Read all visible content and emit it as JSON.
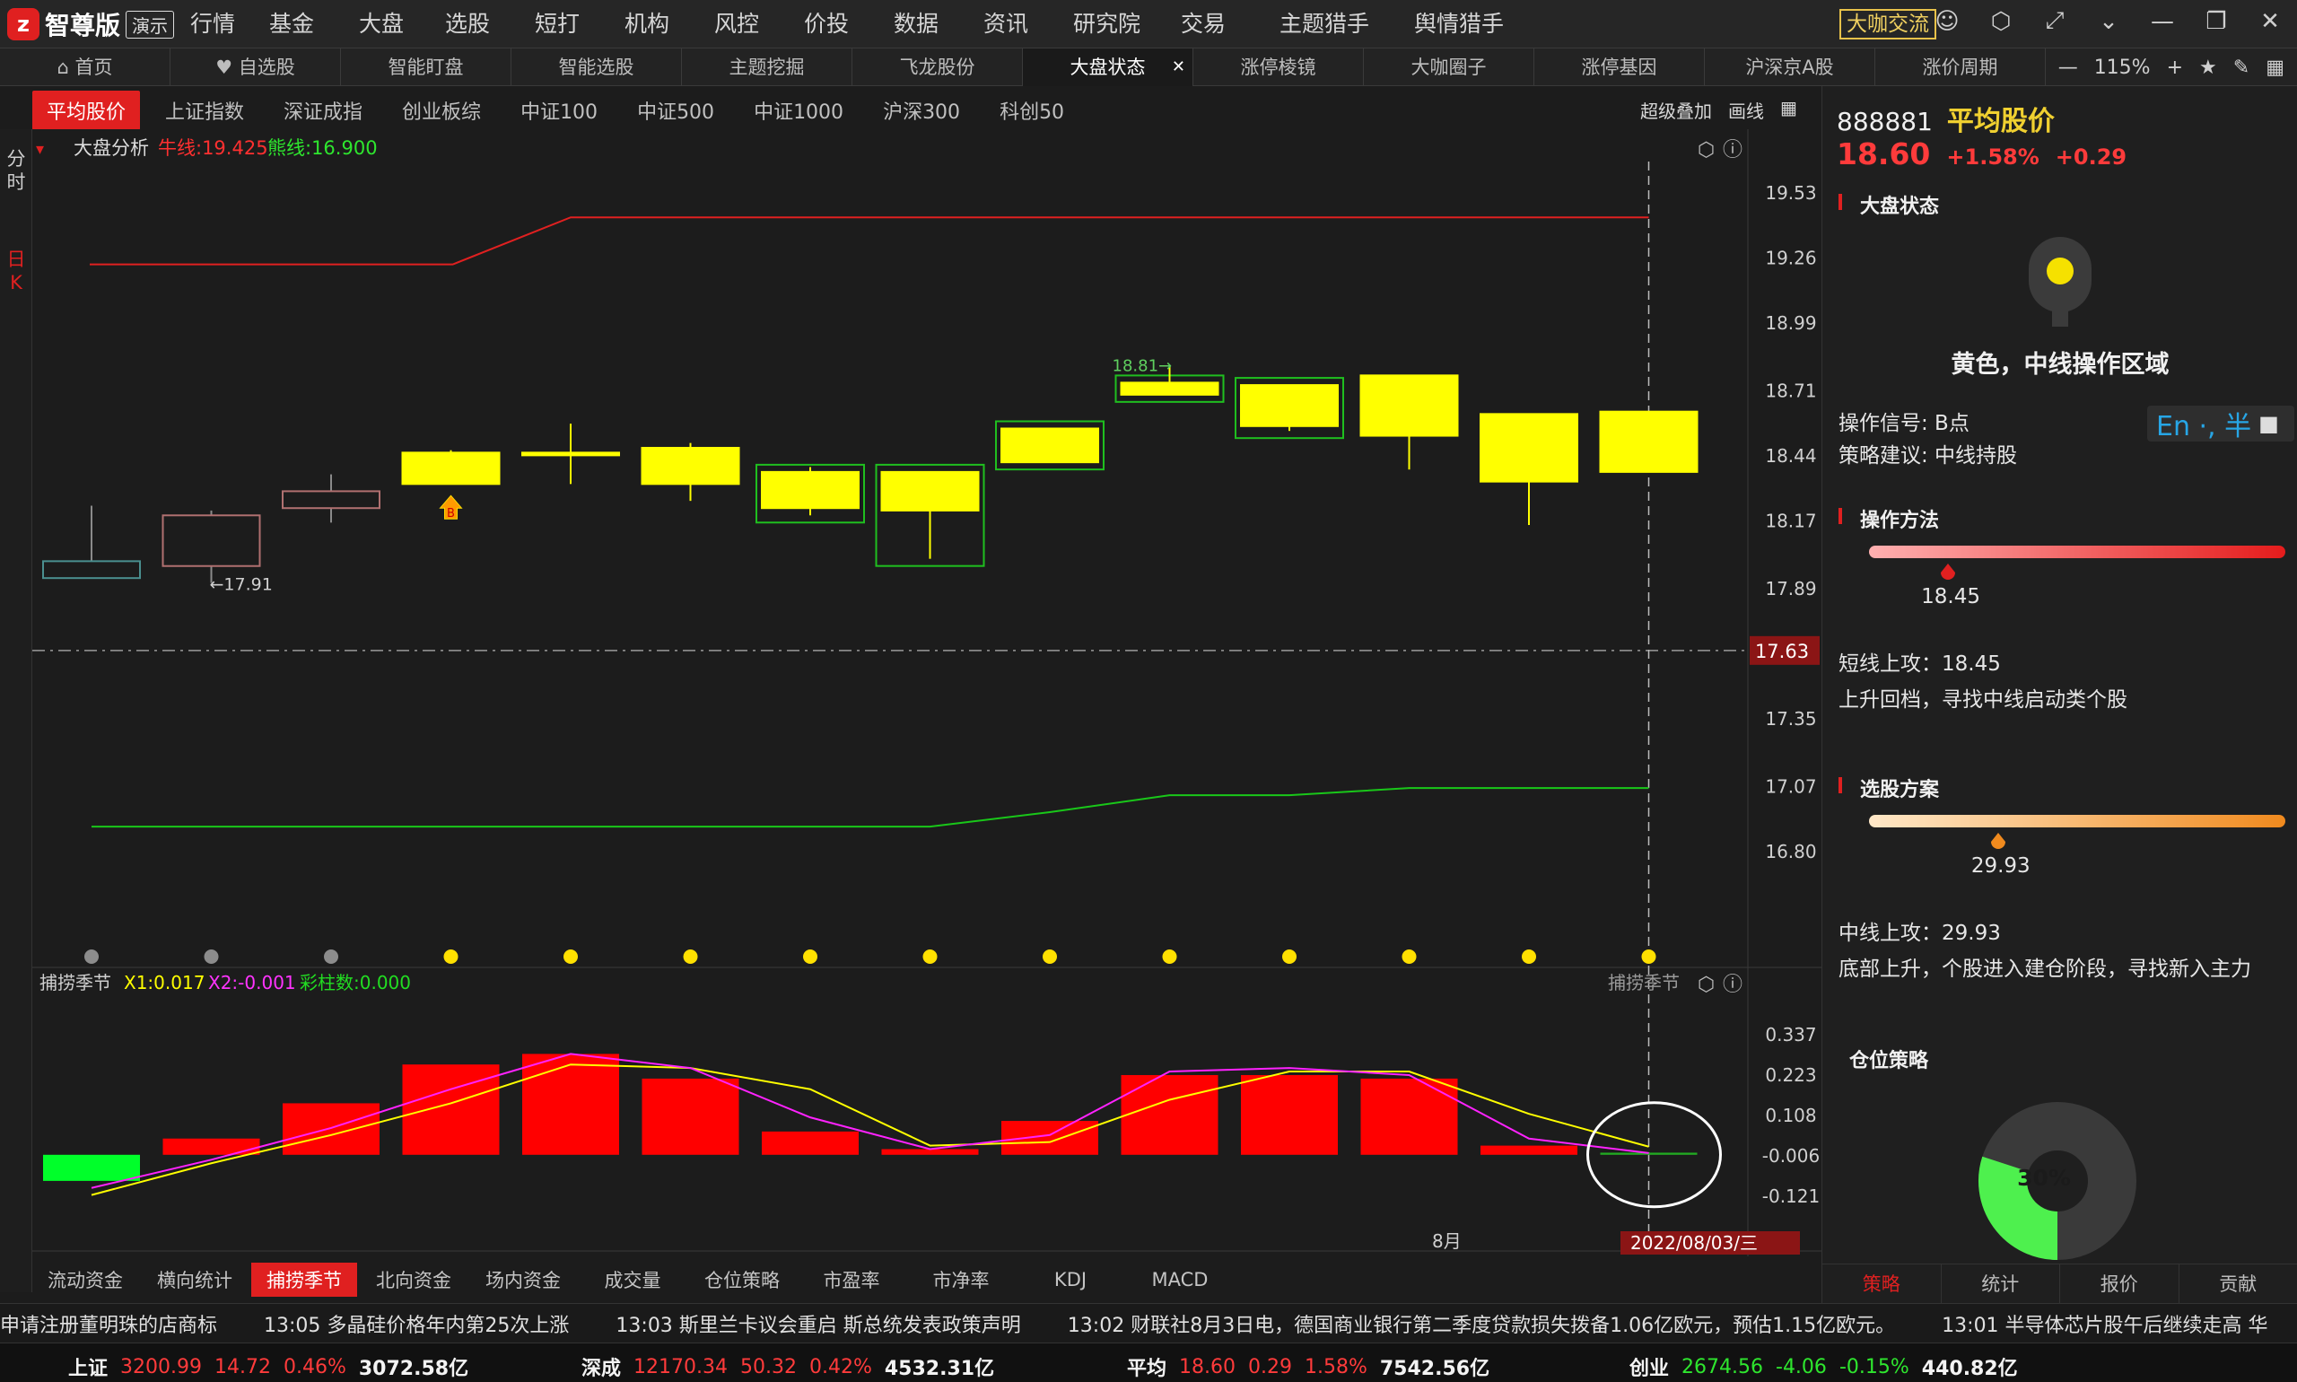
{
  "app": {
    "logo_text": "智尊版",
    "logo_badge": "演示",
    "menu": [
      "行情",
      "基金",
      "大盘",
      "选股",
      "短打",
      "机构",
      "风控",
      "价投",
      "数据",
      "资讯",
      "研究院",
      "交易",
      "主题猎手",
      "舆情猎手"
    ],
    "community_button": "大咖交流"
  },
  "tabs": [
    {
      "label": "首页",
      "icon": "home-icon"
    },
    {
      "label": "自选股",
      "icon": "heart-icon"
    },
    {
      "label": "智能盯盘"
    },
    {
      "label": "智能选股"
    },
    {
      "label": "主题挖掘"
    },
    {
      "label": "飞龙股份"
    },
    {
      "label": "大盘状态",
      "active": true,
      "closable": true
    },
    {
      "label": "涨停棱镜"
    },
    {
      "label": "大咖圈子"
    },
    {
      "label": "涨停基因"
    },
    {
      "label": "沪深京A股"
    },
    {
      "label": "涨价周期"
    }
  ],
  "zoom": {
    "minus": "—",
    "level": "115%",
    "plus": "+"
  },
  "index_tabs": [
    "平均股价",
    "上证指数",
    "深证成指",
    "创业板综",
    "中证100",
    "中证500",
    "中证1000",
    "沪深300",
    "科创50"
  ],
  "chart_tools": {
    "overlay": "超级叠加",
    "draw": "画线"
  },
  "left_strip": {
    "intraday": "分时",
    "daily": "日K"
  },
  "main_panel": {
    "title": "大盘分析",
    "bull_label": "牛线:19.425",
    "bear_label": "熊线:16.900",
    "price_ticks": [
      "19.53",
      "19.26",
      "18.99",
      "18.71",
      "18.44",
      "18.17",
      "17.89",
      "17.63",
      "17.35",
      "17.07",
      "16.80"
    ],
    "current_price_tag": "17.63",
    "low_marker": "17.91",
    "high_marker": "18.81"
  },
  "sub_panel": {
    "name": "捕捞季节",
    "x1_label": "X1:0.017",
    "x2_label": "X2:-0.001",
    "bars_label": "彩柱数:0.000",
    "y_ticks": [
      "0.337",
      "0.223",
      "0.108",
      "-0.006",
      "-0.121"
    ],
    "month_label": "8月",
    "date_tag": "2022/08/03/三"
  },
  "chart_data": {
    "type": "candlestick",
    "bull_line": [
      19.23,
      19.23,
      19.23,
      19.23,
      19.425,
      19.425,
      19.425,
      19.425,
      19.425,
      19.425,
      19.425,
      19.425,
      19.425,
      19.425
    ],
    "bear_line": [
      16.9,
      16.9,
      16.9,
      16.9,
      16.9,
      16.9,
      16.9,
      16.9,
      16.96,
      17.03,
      17.03,
      17.06,
      17.06,
      17.06
    ],
    "candles": [
      {
        "open": 18.0,
        "close": 17.93,
        "high": 18.23,
        "low": 17.93,
        "color": "gray"
      },
      {
        "open": 17.98,
        "close": 18.19,
        "high": 18.21,
        "low": 17.91,
        "color": "gray"
      },
      {
        "open": 18.22,
        "close": 18.29,
        "high": 18.36,
        "low": 18.16,
        "color": "gray"
      },
      {
        "open": 18.32,
        "close": 18.45,
        "high": 18.46,
        "low": 18.32,
        "color": "yellow"
      },
      {
        "open": 18.44,
        "close": 18.45,
        "high": 18.57,
        "low": 18.32,
        "color": "yellow"
      },
      {
        "open": 18.32,
        "close": 18.47,
        "high": 18.49,
        "low": 18.25,
        "color": "yellow"
      },
      {
        "open": 18.37,
        "close": 18.22,
        "high": 18.39,
        "low": 18.19,
        "color": "yellow"
      },
      {
        "open": 18.37,
        "close": 18.21,
        "high": 18.37,
        "low": 18.01,
        "color": "yellow"
      },
      {
        "open": 18.41,
        "close": 18.55,
        "high": 18.55,
        "low": 18.41,
        "color": "yellow"
      },
      {
        "open": 18.74,
        "close": 18.69,
        "high": 18.81,
        "low": 18.69,
        "color": "yellow"
      },
      {
        "open": 18.73,
        "close": 18.56,
        "high": 18.73,
        "low": 18.54,
        "color": "yellow"
      },
      {
        "open": 18.52,
        "close": 18.77,
        "high": 18.77,
        "low": 18.38,
        "color": "yellow"
      },
      {
        "open": 18.33,
        "close": 18.61,
        "high": 18.61,
        "low": 18.15,
        "color": "yellow"
      },
      {
        "open": 18.37,
        "close": 18.62,
        "high": 18.62,
        "low": 18.37,
        "color": "yellow"
      }
    ],
    "boxed_candles": [
      6,
      7,
      8,
      9,
      10
    ],
    "signal_dots": [
      "gray",
      "gray",
      "gray",
      "yellow",
      "yellow",
      "yellow",
      "yellow",
      "yellow",
      "yellow",
      "yellow",
      "yellow",
      "yellow",
      "yellow",
      "yellow"
    ],
    "buy_signal_index": 3,
    "indicator": {
      "bars": [
        -0.08,
        0.04,
        0.14,
        0.25,
        0.28,
        0.21,
        0.06,
        0.01,
        0.09,
        0.22,
        0.22,
        0.21,
        0.02,
        0.0
      ],
      "x1": [
        -0.12,
        -0.03,
        0.05,
        0.14,
        0.25,
        0.24,
        0.18,
        0.02,
        0.03,
        0.15,
        0.23,
        0.23,
        0.11,
        0.017
      ],
      "x2": [
        -0.1,
        -0.02,
        0.07,
        0.18,
        0.28,
        0.24,
        0.1,
        0.01,
        0.05,
        0.23,
        0.24,
        0.22,
        0.04,
        -0.001
      ]
    }
  },
  "indicator_tabs": [
    "流动资金",
    "横向统计",
    "捕捞季节",
    "北向资金",
    "场内资金",
    "成交量",
    "仓位策略",
    "市盈率",
    "市净率",
    "KDJ",
    "MACD"
  ],
  "news": [
    "申请注册董明珠的店商标",
    "13:05 多晶硅价格年内第25次上涨",
    "13:03 斯里兰卡议会重启 斯总统发表政策声明",
    "13:02 财联社8月3日电，德国商业银行第二季度贷款损失拨备1.06亿欧元，预估1.15亿欧元。",
    "13:01 半导体芯片股午后继续走高 华"
  ],
  "status_bar": [
    {
      "name": "上证",
      "price": "3200.99",
      "change": "14.72",
      "pct": "0.46%",
      "amount": "3072.58亿",
      "dir": "up"
    },
    {
      "name": "深成",
      "price": "12170.34",
      "change": "50.32",
      "pct": "0.42%",
      "amount": "4532.31亿",
      "dir": "up"
    },
    {
      "name": "平均",
      "price": "18.60",
      "change": "0.29",
      "pct": "1.58%",
      "amount": "7542.56亿",
      "dir": "up"
    },
    {
      "name": "创业",
      "price": "2674.56",
      "change": "-4.06",
      "pct": "-0.15%",
      "amount": "440.82亿",
      "dir": "down"
    }
  ],
  "right_panel": {
    "code": "888881",
    "name": "平均股价",
    "price": "18.60",
    "pct": "+1.58%",
    "change": "+0.29",
    "section_market": "大盘状态",
    "light_status": "黄色，中线操作区域",
    "signal": "操作信号: B点",
    "advice": "策略建议: 中线持股",
    "ime_text": "En ·, 半",
    "section_method": "操作方法",
    "method_value": "18.45",
    "method_fraction": 0.19,
    "short_attack": "短线上攻：18.45",
    "short_desc": "上升回档，寻找中线启动类个股",
    "section_pick": "选股方案",
    "pick_value": "29.93",
    "pick_fraction": 0.31,
    "mid_attack": "中线上攻：29.93",
    "mid_desc": "底部上升，个股进入建仓阶段，寻找新入主力",
    "section_position": "仓位策略",
    "position_pct": "30%",
    "position_fraction": 0.3,
    "bottom_tabs": [
      "策略",
      "统计",
      "报价",
      "贡献"
    ]
  },
  "colors": {
    "up": "#ff3b3b",
    "down": "#2ee62e",
    "accent": "#e02020",
    "candle_yellow": "#ffff00",
    "bull": "#e02020",
    "bear": "#19c719"
  }
}
